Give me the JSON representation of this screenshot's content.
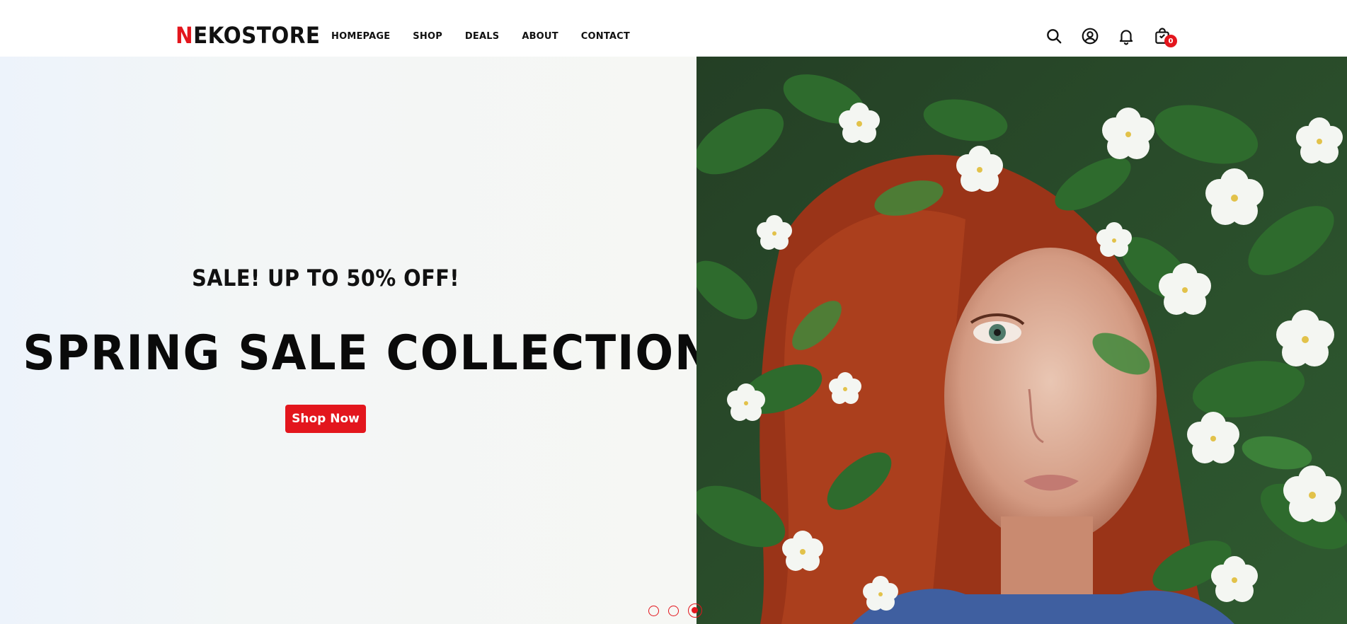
{
  "brand": {
    "logo_first_letter": "N",
    "logo_rest": "EKOSTORE",
    "accent_color": "#e3161d"
  },
  "nav": {
    "items": [
      {
        "label": "HOMEPAGE"
      },
      {
        "label": "SHOP"
      },
      {
        "label": "DEALS"
      },
      {
        "label": "ABOUT"
      },
      {
        "label": "CONTACT"
      }
    ]
  },
  "header_icons": {
    "search": "search-icon",
    "account": "user-icon",
    "notifications": "bell-icon",
    "cart": "cart-icon",
    "cart_count": "0"
  },
  "hero": {
    "subtitle": "SALE! UP TO 50% OFF!",
    "title": "SPRING SALE COLLECTIONS",
    "cta_label": "Shop Now",
    "image_description": "woman-with-red-hair-among-white-flowers",
    "slides": 3,
    "active_slide": 3
  }
}
